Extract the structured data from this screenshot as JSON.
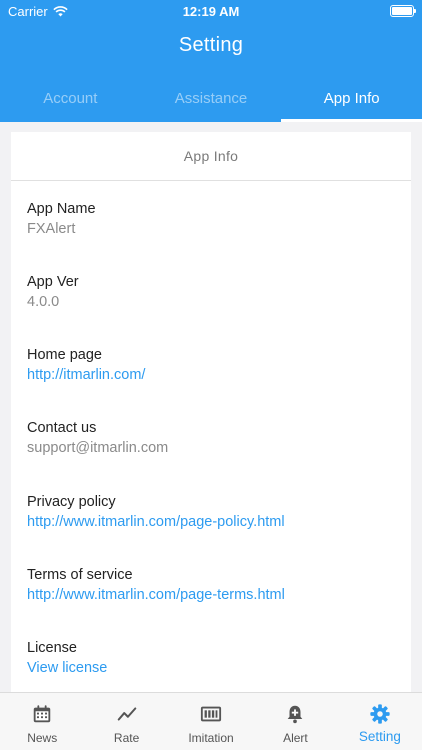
{
  "status_bar": {
    "carrier": "Carrier",
    "time": "12:19 AM"
  },
  "nav": {
    "title": "Setting"
  },
  "tabs": [
    {
      "label": "Account",
      "active": false
    },
    {
      "label": "Assistance",
      "active": false
    },
    {
      "label": "App Info",
      "active": true
    }
  ],
  "card": {
    "title": "App Info",
    "items": [
      {
        "label": "App Name",
        "value": "FXAlert",
        "is_link": false
      },
      {
        "label": "App Ver",
        "value": "4.0.0",
        "is_link": false
      },
      {
        "label": "Home page",
        "value": "http://itmarlin.com/",
        "is_link": true
      },
      {
        "label": "Contact us",
        "value": "support@itmarlin.com",
        "is_link": false
      },
      {
        "label": "Privacy policy",
        "value": "http://www.itmarlin.com/page-policy.html",
        "is_link": true
      },
      {
        "label": "Terms of service",
        "value": "http://www.itmarlin.com/page-terms.html",
        "is_link": true
      },
      {
        "label": "License",
        "value": "View license",
        "is_link": true
      }
    ]
  },
  "bottom_nav": [
    {
      "label": "News",
      "icon": "calendar-icon"
    },
    {
      "label": "Rate",
      "icon": "line-chart-icon"
    },
    {
      "label": "Imitation",
      "icon": "ticker-board-icon"
    },
    {
      "label": "Alert",
      "icon": "bell-plus-icon"
    },
    {
      "label": "Setting",
      "icon": "gear-icon",
      "active": true
    }
  ],
  "colors": {
    "accent": "#2d9bf0",
    "link": "#2d9bf0",
    "background": "#f2f2f4"
  }
}
